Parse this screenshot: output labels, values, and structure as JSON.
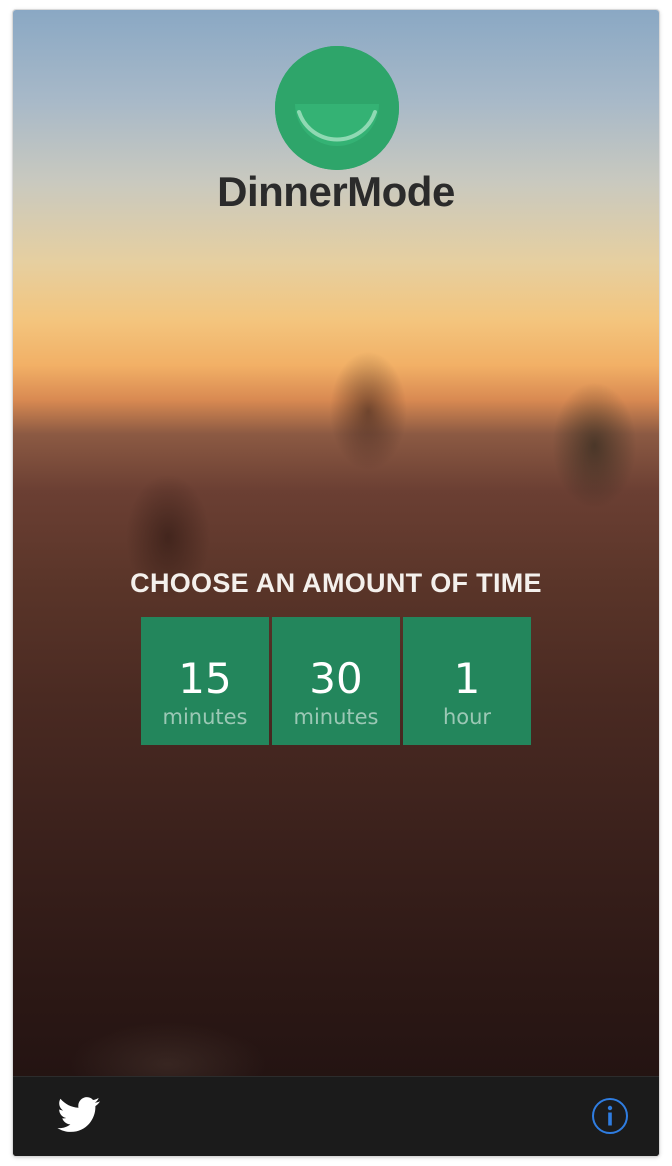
{
  "app": {
    "name": "DinnerMode",
    "logo_icon": "plate-smile-icon"
  },
  "main": {
    "prompt": "CHOOSE AN AMOUNT OF TIME",
    "options": [
      {
        "value": "15",
        "unit": "minutes"
      },
      {
        "value": "30",
        "unit": "minutes"
      },
      {
        "value": "1",
        "unit": "hour"
      }
    ]
  },
  "footer": {
    "left_icon": "twitter-icon",
    "right_icon": "info-icon"
  },
  "colors": {
    "brand_green": "#2ea56a",
    "tile_green": "#23865c",
    "footer_bg": "#1b1b1b",
    "info_blue": "#2f7de1"
  }
}
